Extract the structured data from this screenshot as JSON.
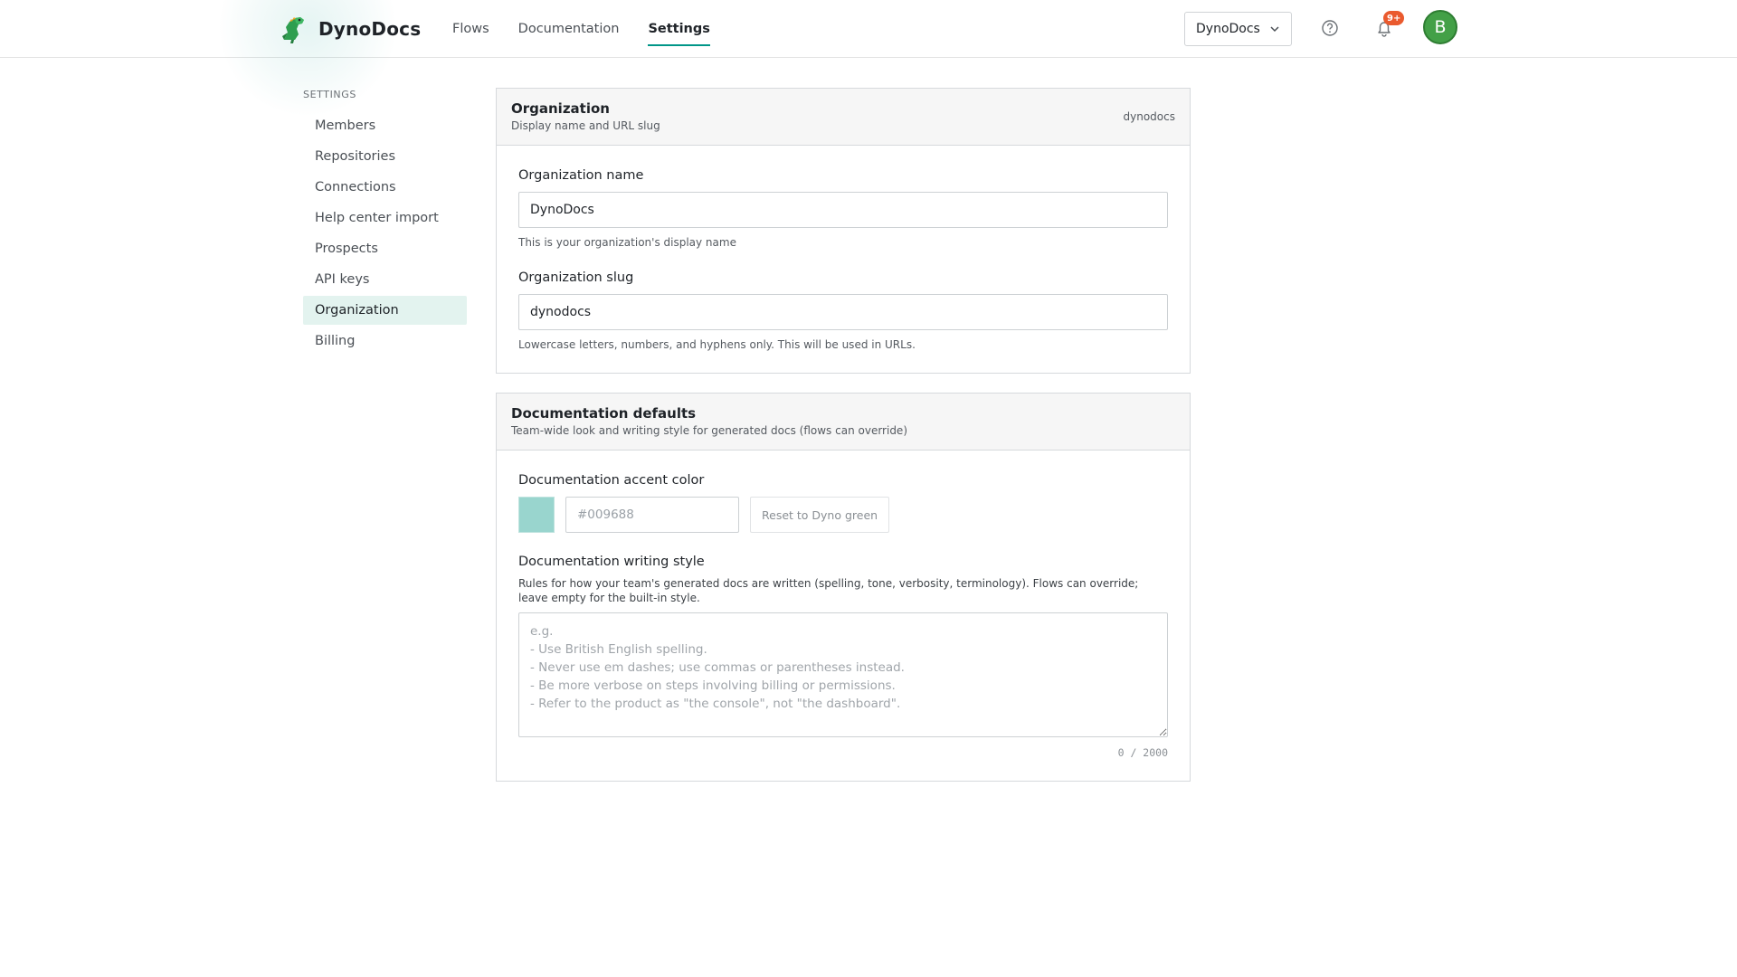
{
  "header": {
    "brand": "DynoDocs",
    "nav": [
      {
        "label": "Flows"
      },
      {
        "label": "Documentation"
      },
      {
        "label": "Settings"
      }
    ],
    "org_switcher": "DynoDocs",
    "notifications_badge": "9+",
    "avatar_initial": "B",
    "accent_color": "#009688"
  },
  "sidebar": {
    "heading": "SETTINGS",
    "items": [
      {
        "label": "Members"
      },
      {
        "label": "Repositories"
      },
      {
        "label": "Connections"
      },
      {
        "label": "Help center import"
      },
      {
        "label": "Prospects"
      },
      {
        "label": "API keys"
      },
      {
        "label": "Organization"
      },
      {
        "label": "Billing"
      }
    ],
    "active_item": "Organization"
  },
  "organization_card": {
    "title": "Organization",
    "subtitle": "Display name and URL slug",
    "slug_display": "dynodocs",
    "name_label": "Organization name",
    "name_value": "DynoDocs",
    "name_help": "This is your organization's display name",
    "slug_label": "Organization slug",
    "slug_value": "dynodocs",
    "slug_help": "Lowercase letters, numbers, and hyphens only. This will be used in URLs."
  },
  "docs_card": {
    "title": "Documentation defaults",
    "subtitle": "Team-wide look and writing style for generated docs (flows can override)",
    "accent_label": "Documentation accent color",
    "accent_placeholder": "#009688",
    "accent_swatch_color": "#99d5ce",
    "reset_button": "Reset to Dyno green",
    "style_label": "Documentation writing style",
    "style_description": "Rules for how your team's generated docs are written (spelling, tone, verbosity, terminology). Flows can override; leave empty for the built-in style.",
    "style_placeholder": "e.g.\n- Use British English spelling.\n- Never use em dashes; use commas or parentheses instead.\n- Be more verbose on steps involving billing or permissions.\n- Refer to the product as \"the console\", not \"the dashboard\".",
    "counter": "0 / 2000"
  }
}
